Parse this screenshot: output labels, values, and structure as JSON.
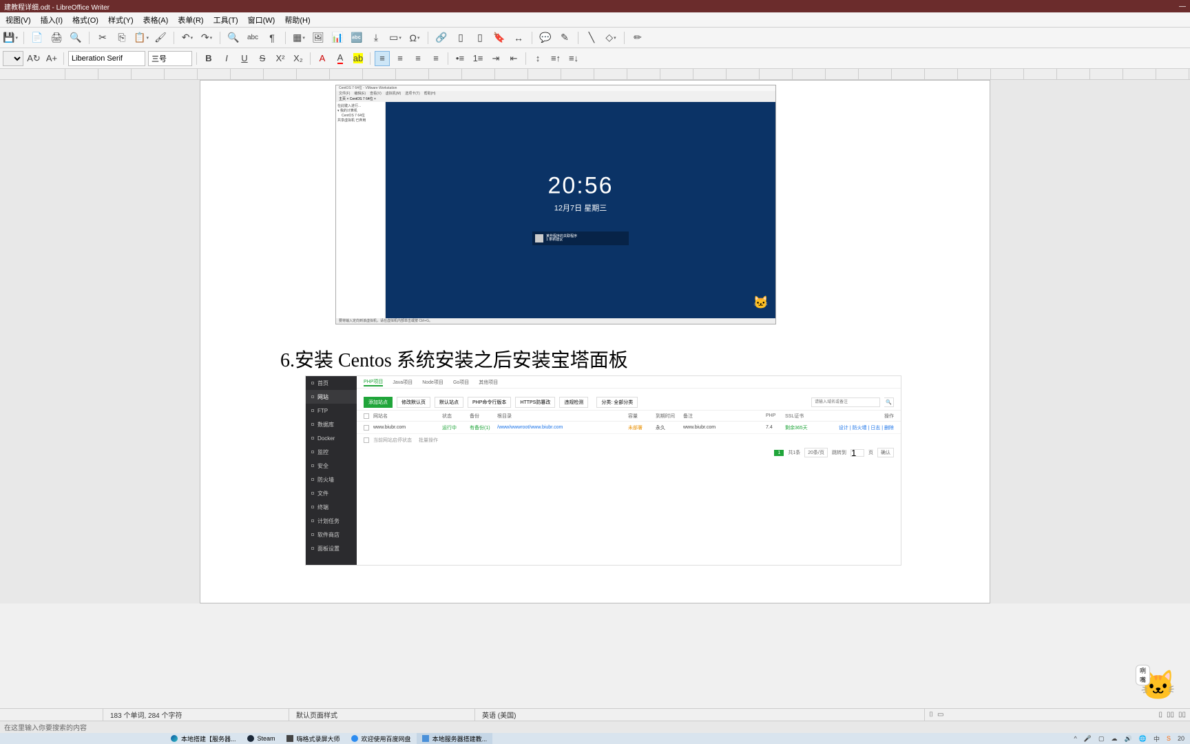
{
  "titlebar": {
    "title": "建教程详细.odt - LibreOffice Writer"
  },
  "menu": {
    "view": "视图(V)",
    "insert": "插入(I)",
    "format": "格式(O)",
    "styles": "样式(Y)",
    "table": "表格(A)",
    "form": "表单(R)",
    "tools": "工具(T)",
    "window": "窗口(W)",
    "help": "帮助(H)"
  },
  "toolbar2": {
    "font": "Liberation Serif",
    "size": "三号"
  },
  "vm": {
    "title": "CentOS 7 64位 - VMware Workstation",
    "menu": [
      "文件(F)",
      "编辑(E)",
      "查看(V)",
      "虚拟机(M)",
      "选项卡(T)",
      "帮助(H)"
    ],
    "tab_home": "主页",
    "tab_centos": "CentOS 7 64位",
    "side": [
      "在此键入进行...",
      "我的计算机",
      "CentOS 7 64位",
      "共享虚拟机 已弃用"
    ],
    "time": "20:56",
    "date": "12月7日 星期三",
    "notif_title": "某些程序的关联程序",
    "notif_sub": "1 条新建议",
    "status": "要将输入定向到该虚拟机，请在虚拟机内部单击或按 Ctrl+G。"
  },
  "heading": "6.安装 Centos 系统安装之后安装宝塔面板",
  "bt": {
    "side": [
      "首页",
      "网站",
      "FTP",
      "数据库",
      "Docker",
      "监控",
      "安全",
      "防火墙",
      "文件",
      "终端",
      "计划任务",
      "软件商店",
      "面板设置"
    ],
    "tabs": [
      "PHP项目",
      "Java项目",
      "Node项目",
      "Go项目",
      "其他项目"
    ],
    "btns": [
      "添加站点",
      "修改默认页",
      "默认站点",
      "PHP命令行版本",
      "HTTPS防篡改",
      "违规检测"
    ],
    "cat": "分类: 全部分类",
    "search_ph": "请输入域名或备注",
    "head": [
      "",
      "网站名",
      "状态",
      "备份",
      "根目录",
      "容量",
      "到期时间",
      "备注",
      "PHP",
      "SSL证书",
      "操作"
    ],
    "row": {
      "name": "www.biubr.com",
      "status": "运行中",
      "backup": "有备份(1)",
      "root": "/www/wwwroot/www.biubr.com",
      "cap": "未部署",
      "expire": "永久",
      "note": "www.biubr.com",
      "php": "7.4",
      "ssl": "剩余365天",
      "ops": "设计 | 防火墙 | 日志 | 删除"
    },
    "row2": {
      "chk": "当前网站启停状态",
      "batch": "批量操作"
    },
    "pager": {
      "total": "共1条",
      "size": "20条/页",
      "goto": "跳转到",
      "page_lbl": "页",
      "conf": "确认"
    }
  },
  "status": {
    "words": "183 个单词, 284 个字符",
    "style": "默认页面样式",
    "lang": "英语 (美国)"
  },
  "searchhint": "在这里输入你要搜索的内容",
  "taskbar": {
    "t1": "本地搭建【服务器...",
    "t2": "Steam",
    "t3": "嗨格式录屏大师",
    "t4": "欢迎使用百度网盘",
    "t5": "本地服务器搭建教...",
    "time": "20"
  },
  "mascot_text": "咧嘴"
}
